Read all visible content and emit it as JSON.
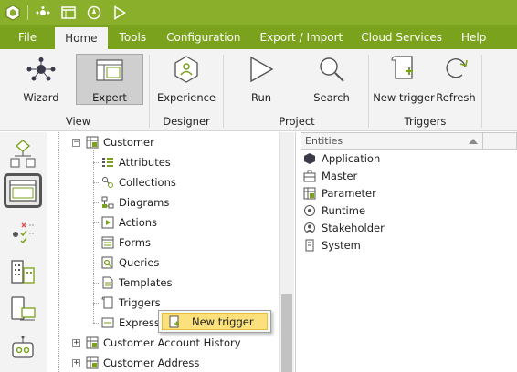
{
  "quick_access": {
    "icons": [
      "app-logo-icon",
      "network-icon",
      "window-icon",
      "compass-icon",
      "play-icon"
    ]
  },
  "menu": {
    "tabs": [
      "File",
      "Home",
      "Tools",
      "Configuration",
      "Export / Import",
      "Cloud Services",
      "Help"
    ],
    "active": "Home"
  },
  "ribbon": {
    "buttons": {
      "wizard": "Wizard",
      "expert": "Expert",
      "experience": "Experience",
      "run": "Run",
      "search": "Search",
      "new_trigger": "New trigger",
      "refresh": "Refresh"
    },
    "groups": {
      "view": "View",
      "designer": "Designer",
      "project": "Project",
      "triggers": "Triggers"
    }
  },
  "tree": {
    "customer": "Customer",
    "children": {
      "attributes": "Attributes",
      "collections": "Collections",
      "diagrams": "Diagrams",
      "actions": "Actions",
      "forms": "Forms",
      "queries": "Queries",
      "templates": "Templates",
      "triggers": "Triggers",
      "expressions": "Expressi"
    },
    "customer_account_history": "Customer Account History",
    "customer_address": "Customer Address"
  },
  "context_menu": {
    "new_trigger": "New trigger"
  },
  "entities": {
    "header": "Entities",
    "items": [
      "Application",
      "Master",
      "Parameter",
      "Runtime",
      "Stakeholder",
      "System"
    ]
  },
  "colors": {
    "titlebar": "#8aaf2a",
    "menubar": "#7aa21c",
    "highlight": "#fbe07c"
  }
}
